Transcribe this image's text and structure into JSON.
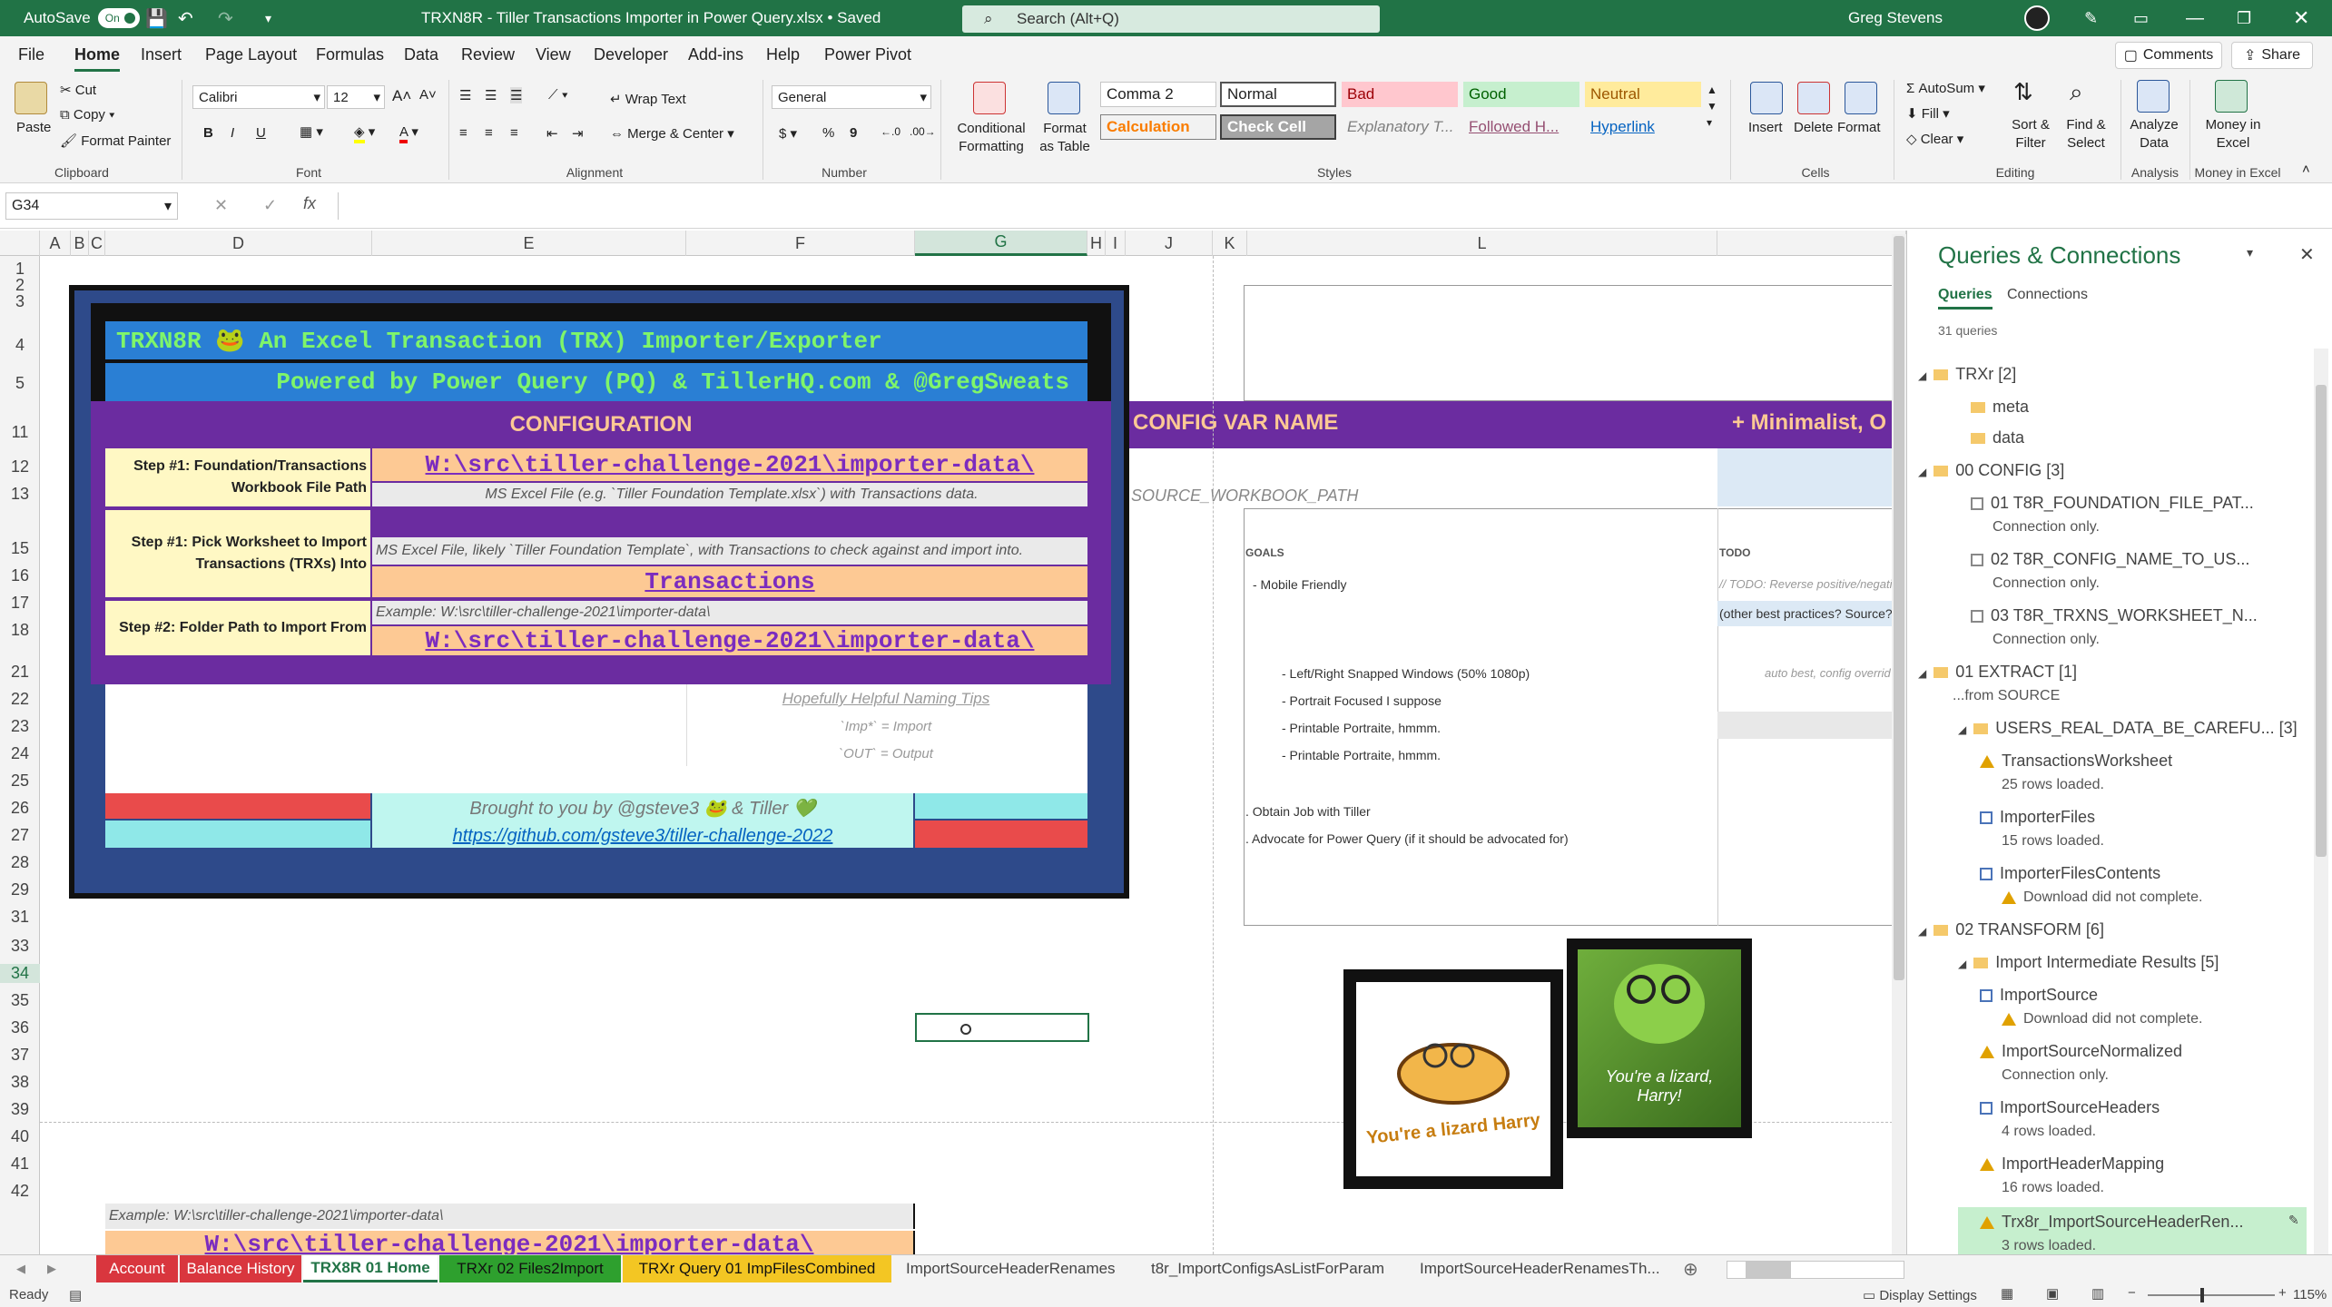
{
  "titlebar": {
    "autosave": "AutoSave",
    "autosave_state": "On",
    "doc_title": "TRXN8R - Tiller Transactions Importer in Power Query.xlsx • Saved",
    "search_placeholder": "Search (Alt+Q)",
    "user": "Greg Stevens"
  },
  "menu": {
    "tabs": [
      "File",
      "Home",
      "Insert",
      "Page Layout",
      "Formulas",
      "Data",
      "Review",
      "View",
      "Developer",
      "Add-ins",
      "Help",
      "Power Pivot"
    ],
    "comments": "Comments",
    "share": "Share"
  },
  "ribbon": {
    "paste": "Paste",
    "cut": "Cut",
    "copy": "Copy",
    "format_painter": "Format Painter",
    "clipboard": "Clipboard",
    "font_name": "Calibri",
    "font_size": "12",
    "font": "Font",
    "bold": "B",
    "italic": "I",
    "underline": "U",
    "wrap_text": "Wrap Text",
    "merge_center": "Merge & Center",
    "alignment": "Alignment",
    "number_format": "General",
    "number": "Number",
    "currency": "$",
    "percent": "%",
    "comma": "9",
    "conditional": "Conditional Formatting",
    "format_as_table": "Format as Table",
    "styles": [
      [
        "Comma 2",
        "Normal",
        "Bad",
        "Good",
        "Neutral"
      ],
      [
        "Calculation",
        "Check Cell",
        "Explanatory T...",
        "Followed H...",
        "Hyperlink"
      ]
    ],
    "styles_label": "Styles",
    "insert": "Insert",
    "delete": "Delete",
    "format": "Format",
    "cells": "Cells",
    "autosum": "AutoSum",
    "fill": "Fill",
    "clear": "Clear",
    "sort_filter": "Sort & Filter",
    "find_select": "Find & Select",
    "editing": "Editing",
    "analyze_data": "Analyze Data",
    "analysis": "Analysis",
    "money_in_excel": "Money in Excel",
    "money_group": "Money in Excel"
  },
  "formula": {
    "namebox": "G34",
    "fx": "fx",
    "value": ""
  },
  "grid": {
    "columns": [
      "A",
      "B",
      "C",
      "D",
      "E",
      "F",
      "G",
      "H",
      "I",
      "J",
      "K",
      "L"
    ],
    "rows": [
      "1",
      "2",
      "3",
      "4",
      "5",
      "11",
      "12",
      "13",
      "15",
      "16",
      "17",
      "18",
      "21",
      "22",
      "23",
      "24",
      "25",
      "26",
      "27",
      "28",
      "29",
      "31",
      "33",
      "34",
      "35",
      "36",
      "37",
      "38",
      "39",
      "40",
      "41",
      "42"
    ],
    "selected_col": "G",
    "selected_row": "34"
  },
  "config": {
    "title_line1": "TRXN8R 🐸 An Excel Transaction (TRX) Importer/Exporter",
    "title_line2": "Powered by Power Query (PQ) & TillerHQ.com & @GregSweats",
    "header": "CONFIGURATION",
    "step1_label": "Step #1:  Foundation/Transactions Workbook File Path",
    "step1_value": "W:\\src\\tiller-challenge-2021\\importer-data\\",
    "step1_hint": "MS Excel File  (e.g. `Tiller Foundation Template.xlsx`) with  Transactions  data.",
    "step1b_label": "Step #1:  Pick Worksheet to Import Transactions (TRXs) Into",
    "step1b_hint": "MS Excel File, likely `Tiller Foundation Template`, with Transactions to check against and import into.",
    "step1b_value": "Transactions",
    "step2_label": "Step #2:  Folder Path to Import From",
    "step2_hint": "Example:    W:\\src\\tiller-challenge-2021\\importer-data\\",
    "step2_value": "W:\\src\\tiller-challenge-2021\\importer-data\\",
    "tips_title": "Hopefully Helpful Naming Tips",
    "tip1": "`Imp*` =   Import",
    "tip2": "`OUT` =  Output",
    "brought": "Brought to you by @gsteve3 🐸 & Tiller 💚",
    "github": "https://github.com/gsteve3/tiller-challenge-2022"
  },
  "config_right": {
    "var_header": "CONFIG VAR NAME",
    "minimal": "+ Minimalist, O",
    "var_source": "SOURCE_WORKBOOK_PATH",
    "goals": "GOALS",
    "todo": "TODO",
    "todo1": "// TODO: Reverse positive/negati",
    "todo2": "(other best practices? Source?)",
    "todo3": "auto best, config overrid",
    "goal_items": [
      "- Mobile Friendly",
      "- Left/Right Snapped Windows (50% 1080p)",
      "- Portrait Focused I suppose",
      "- Printable Portraite, hmmm.",
      "- Printable Portraite, hmmm.",
      ". Obtain Job with Tiller",
      ". Advocate for Power Query (if it should be advocated for)"
    ]
  },
  "lower": {
    "example": "Example:    W:\\src\\tiller-challenge-2021\\importer-data\\",
    "value": "W:\\src\\tiller-challenge-2021\\importer-data\\"
  },
  "images": {
    "sticker_text": "You're a lizard Harry",
    "photo_text": "You're a lizard, Harry!"
  },
  "queries": {
    "title": "Queries & Connections",
    "tab_queries": "Queries",
    "tab_connections": "Connections",
    "count": "31 queries",
    "items": [
      {
        "label": "TRXr [2]",
        "type": "group",
        "indent": 0
      },
      {
        "label": "meta",
        "type": "folder",
        "indent": 1
      },
      {
        "label": "data",
        "type": "folder",
        "indent": 1
      },
      {
        "label": "00 CONFIG [3]",
        "type": "group",
        "indent": 0
      },
      {
        "label": "01 T8R_FOUNDATION_FILE_PAT...",
        "type": "conn",
        "indent": 1,
        "sub": "Connection only."
      },
      {
        "label": "02 T8R_CONFIG_NAME_TO_US...",
        "type": "conn",
        "indent": 1,
        "sub": "Connection only."
      },
      {
        "label": "03 T8R_TRXNS_WORKSHEET_N...",
        "type": "conn",
        "indent": 1,
        "sub": "Connection only."
      },
      {
        "label": "01 EXTRACT [1]",
        "type": "group",
        "indent": 0,
        "sub": "...from SOURCE"
      },
      {
        "label": "USERS_REAL_DATA_BE_CAREFU... [3]",
        "type": "group",
        "indent": 1
      },
      {
        "label": "TransactionsWorksheet",
        "type": "warn",
        "indent": 2,
        "sub": "25 rows loaded."
      },
      {
        "label": "ImporterFiles",
        "type": "table",
        "indent": 2,
        "sub": "15 rows loaded."
      },
      {
        "label": "ImporterFilesContents",
        "type": "table",
        "indent": 2,
        "sub": "Download did not complete."
      },
      {
        "label": "02 TRANSFORM [6]",
        "type": "group",
        "indent": 0
      },
      {
        "label": "Import Intermediate Results [5]",
        "type": "group",
        "indent": 1
      },
      {
        "label": "ImportSource",
        "type": "table",
        "indent": 2,
        "sub": "Download did not complete."
      },
      {
        "label": "ImportSourceNormalized",
        "type": "warn",
        "indent": 2,
        "sub": "Connection only."
      },
      {
        "label": "ImportSourceHeaders",
        "type": "table",
        "indent": 2,
        "sub": "4 rows loaded."
      },
      {
        "label": "ImportHeaderMapping",
        "type": "warn",
        "indent": 2,
        "sub": "16 rows loaded."
      },
      {
        "label": "Trx8r_ImportSourceHeaderRen...",
        "type": "warn",
        "indent": 2,
        "sub": "3 rows loaded."
      }
    ]
  },
  "sheets": {
    "tabs": [
      "Account",
      "Balance History",
      "TRX8R 01 Home",
      "TRXr 02 Files2Import",
      "TRXr Query 01 ImpFilesCombined",
      "ImportSourceHeaderRenames",
      "t8r_ImportConfigsAsListForParam",
      "ImportSourceHeaderRenamesTh..."
    ],
    "colors": [
      "#d9363e",
      "#d9363e",
      "#ffffff",
      "#2ea02e",
      "#f3c623",
      "#f3f3f3",
      "#f3f3f3",
      "#f3f3f3"
    ],
    "active": 2
  },
  "status": {
    "ready": "Ready",
    "display_settings": "Display Settings",
    "zoom": "115%"
  }
}
